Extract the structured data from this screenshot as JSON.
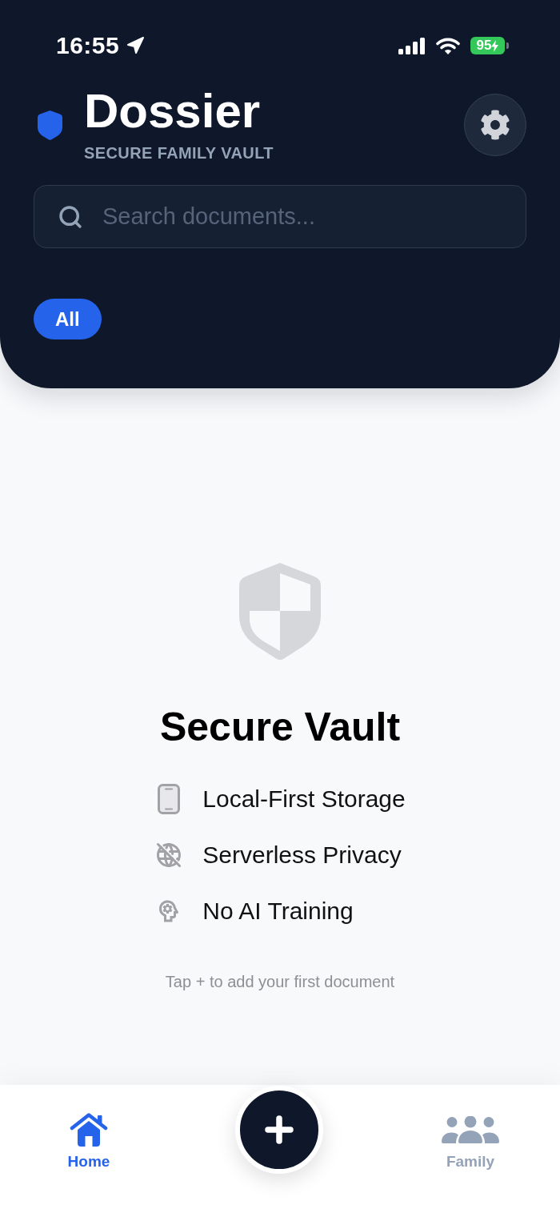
{
  "status_bar": {
    "time": "16:55",
    "battery": "95"
  },
  "header": {
    "title": "Dossier",
    "subtitle": "SECURE FAMILY VAULT",
    "search": {
      "placeholder": "Search documents..."
    },
    "filters": [
      {
        "label": "All",
        "selected": true
      }
    ]
  },
  "empty_state": {
    "title": "Secure Vault",
    "features": [
      {
        "kind": "device",
        "label": "Local-First Storage"
      },
      {
        "kind": "no-network",
        "label": "Serverless Privacy"
      },
      {
        "kind": "mind",
        "label": "No AI Training"
      }
    ],
    "hint": "Tap + to add your first document"
  },
  "tab_bar": {
    "tabs": [
      {
        "kind": "home",
        "label": "Home",
        "selected": true
      },
      {
        "kind": "family",
        "label": "Family",
        "selected": false
      }
    ]
  }
}
